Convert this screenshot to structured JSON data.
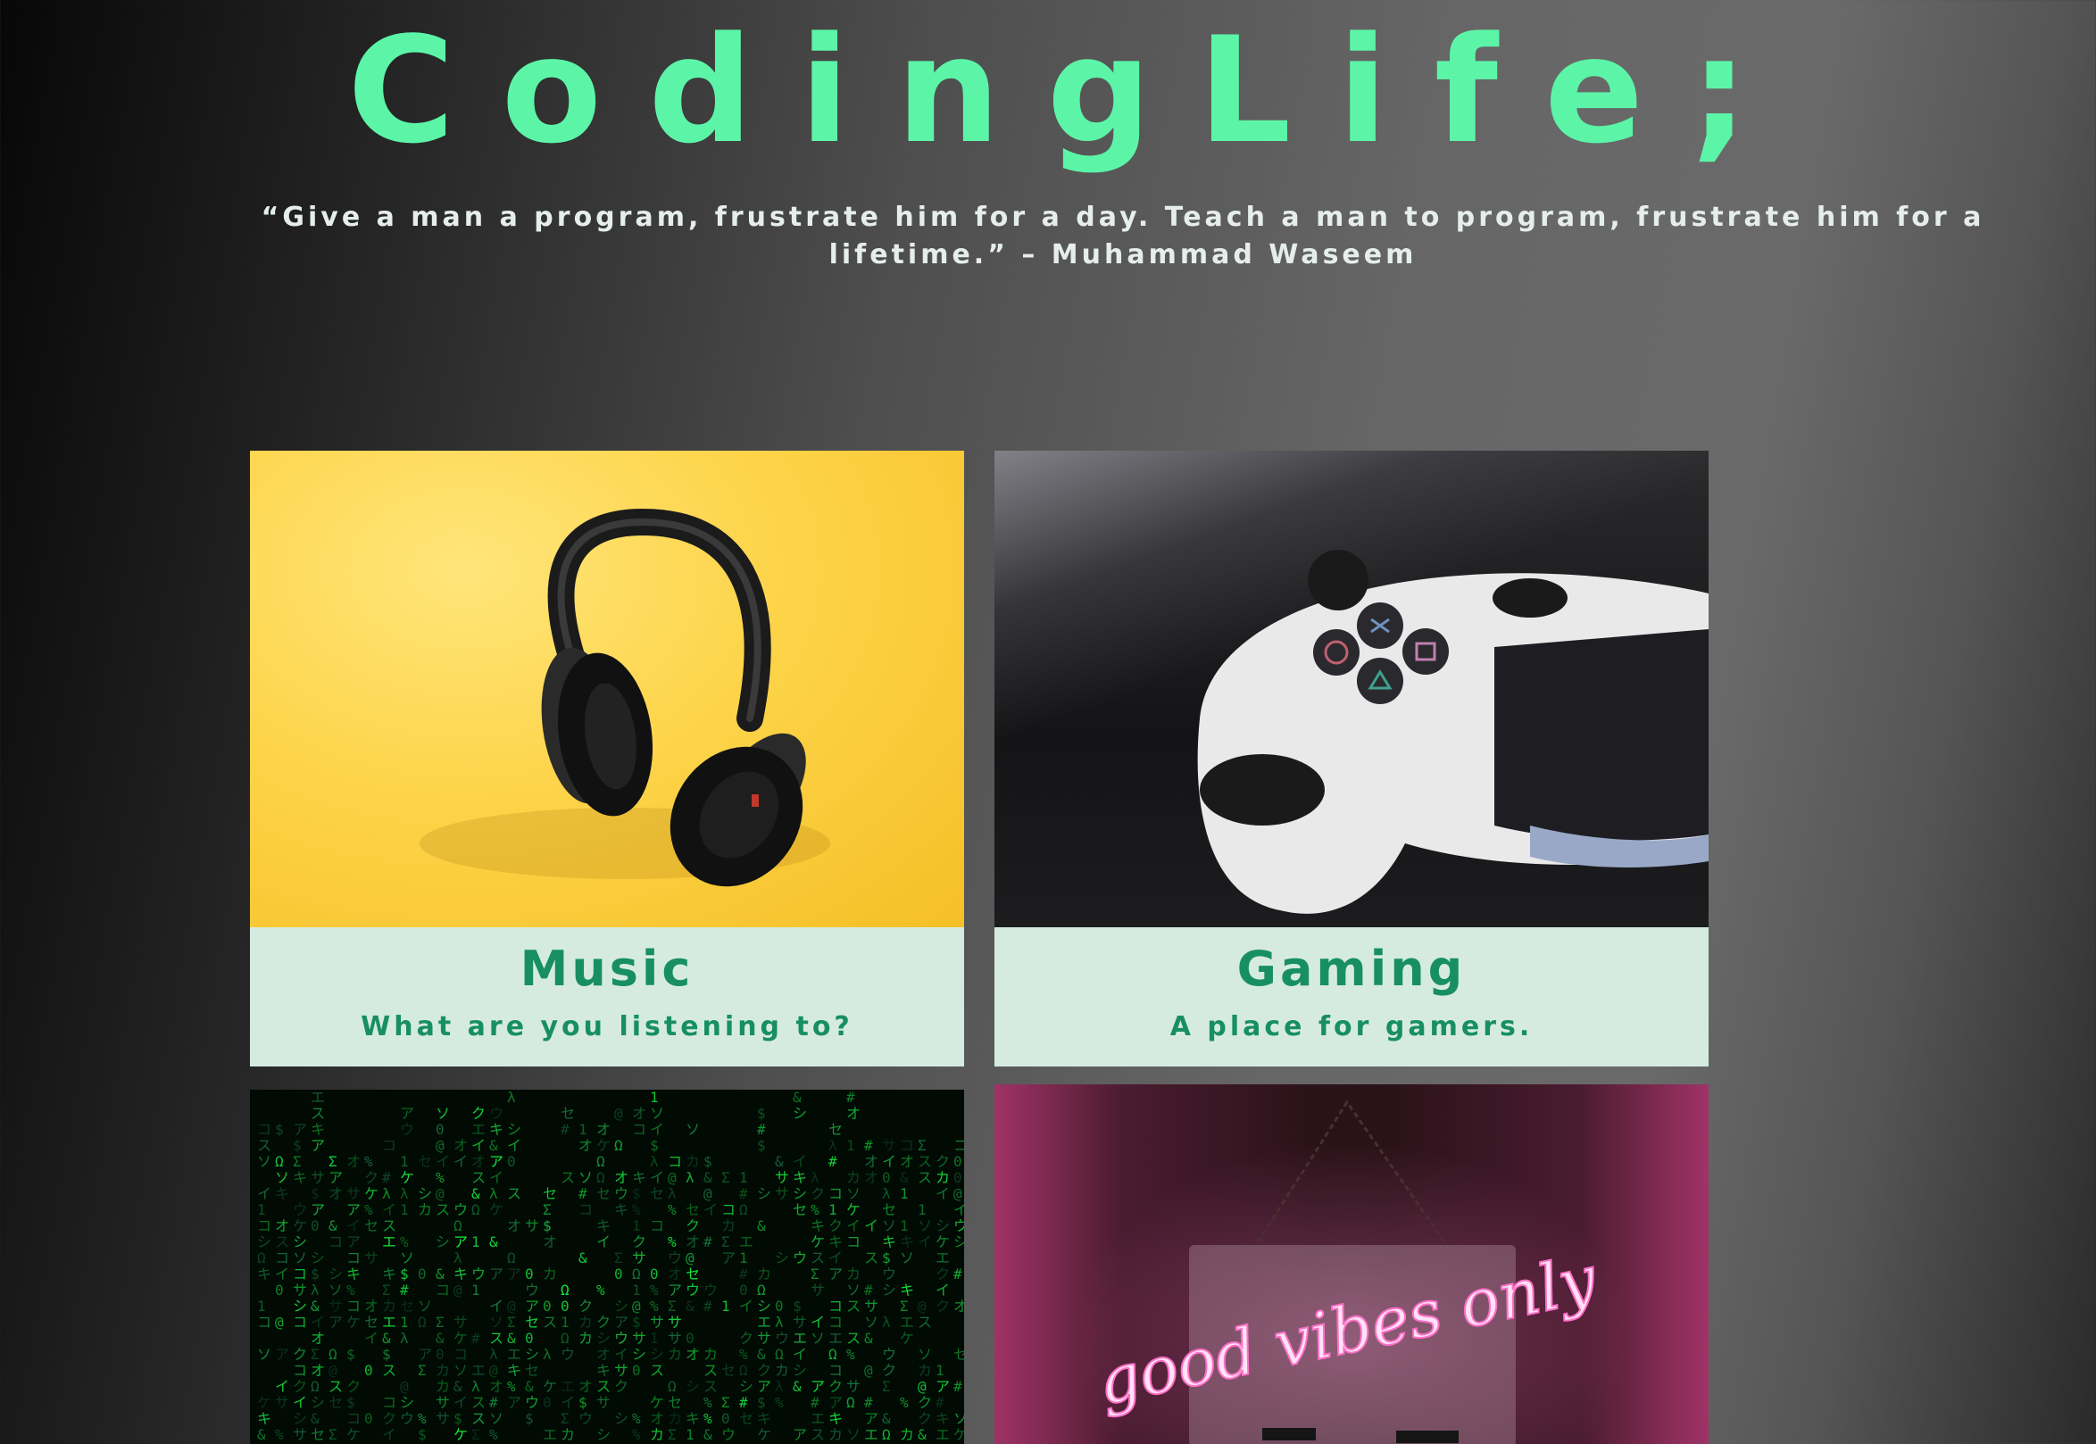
{
  "header": {
    "title": "CodingLife;",
    "quote": "“Give a man a program, frustrate him for a day. Teach a man to program, frustrate him for a lifetime.” – Muhammad Waseem"
  },
  "cards": [
    {
      "title": "Music",
      "subtitle": "What are you listening to?"
    },
    {
      "title": "Gaming",
      "subtitle": "A place for gamers."
    }
  ],
  "neon_sign_text": "good vibes only",
  "colors": {
    "accent": "#5cf5a8",
    "caption_bg": "#d6ebe0",
    "caption_text": "#188f63"
  }
}
